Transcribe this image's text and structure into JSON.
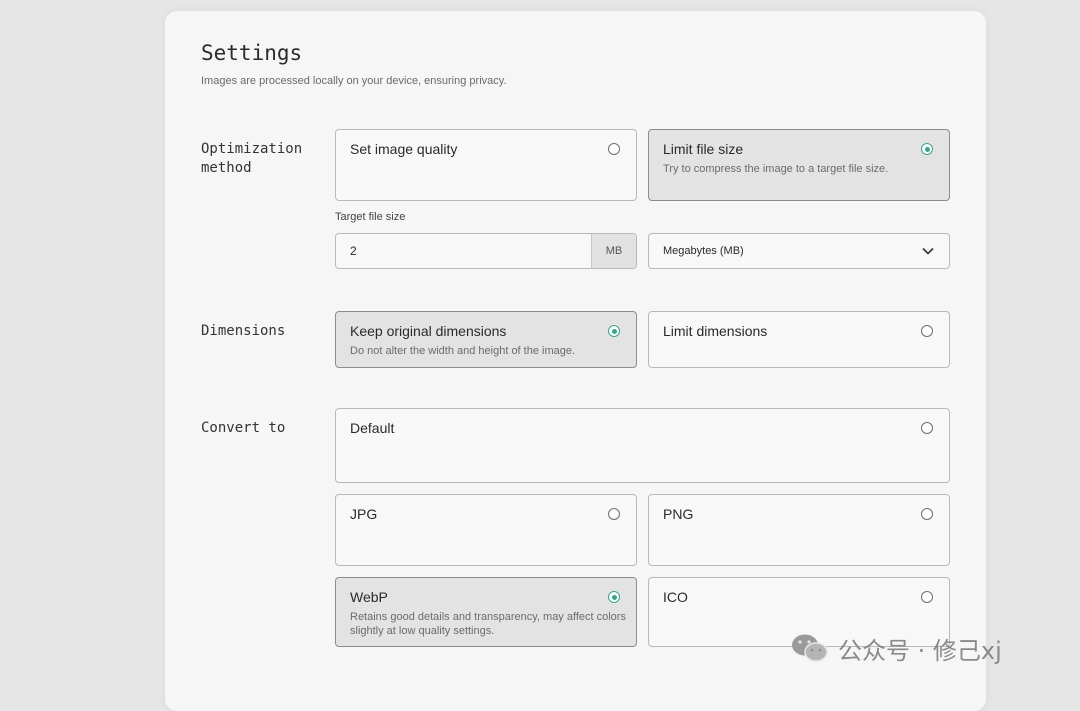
{
  "header": {
    "title": "Settings",
    "subtitle": "Images are processed locally on your device, ensuring privacy."
  },
  "optimization": {
    "label_line1": "Optimization",
    "label_line2": "method",
    "options": [
      {
        "title": "Set image quality",
        "desc": "",
        "selected": false
      },
      {
        "title": "Limit file size",
        "desc": "Try to compress the image to a target file size.",
        "selected": true
      }
    ],
    "target_label": "Target file size",
    "target_value": "2",
    "target_unit": "MB",
    "unit_select": "Megabytes (MB)"
  },
  "dimensions": {
    "label": "Dimensions",
    "options": [
      {
        "title": "Keep original dimensions",
        "desc": "Do not alter the width and height of the image.",
        "selected": true
      },
      {
        "title": "Limit dimensions",
        "desc": "",
        "selected": false
      }
    ]
  },
  "convert": {
    "label": "Convert to",
    "options": [
      {
        "title": "Default",
        "desc": "",
        "selected": false
      },
      {
        "title": "JPG",
        "desc": "",
        "selected": false
      },
      {
        "title": "PNG",
        "desc": "",
        "selected": false
      },
      {
        "title": "WebP",
        "desc": "Retains good details and transparency, may affect colors slightly at low quality settings.",
        "selected": true
      },
      {
        "title": "ICO",
        "desc": "",
        "selected": false
      }
    ]
  },
  "watermark": {
    "text": "公众号 · 修己xj",
    "icon": "wechat-icon"
  },
  "colors": {
    "accent": "#3aa58c",
    "selected_bg": "#e3e3e3"
  }
}
